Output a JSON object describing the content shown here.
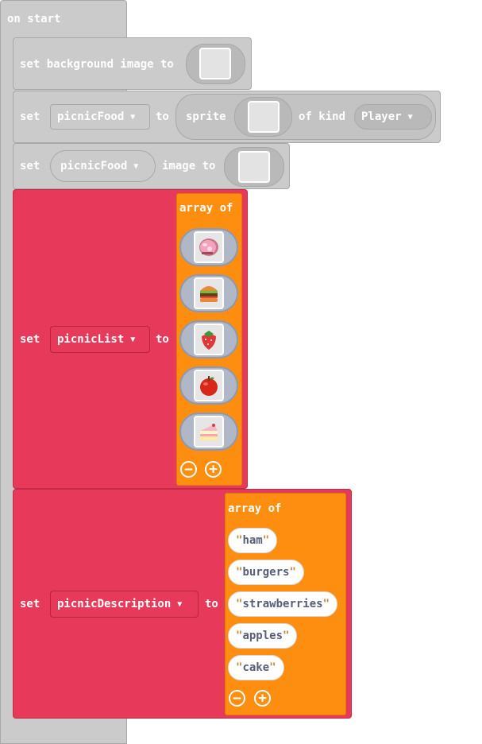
{
  "on_start": {
    "label": "on start"
  },
  "set_bg": {
    "label": "set background image to"
  },
  "set_sprite": {
    "set": "set",
    "var": "picnicFood",
    "to": "to",
    "sprite": "sprite",
    "of_kind": "of kind",
    "kind": "Player"
  },
  "set_image": {
    "set": "set",
    "var": "picnicFood",
    "image_to": "image to"
  },
  "set_list": {
    "set": "set",
    "var": "picnicList",
    "to": "to",
    "array_of": "array of",
    "items": [
      "ham-icon",
      "burger-icon",
      "strawberry-icon",
      "apple-icon",
      "cake-icon"
    ]
  },
  "set_desc": {
    "set": "set",
    "var": "picnicDescription",
    "to": "to",
    "array_of": "array of",
    "strings": [
      "ham",
      "burgers",
      "strawberries",
      "apples",
      "cake"
    ]
  },
  "colors": {
    "grey_block": "#cbcbcb",
    "red_block": "#e7395a",
    "orange_array": "#fe8e10",
    "string_text": "#575e75"
  }
}
